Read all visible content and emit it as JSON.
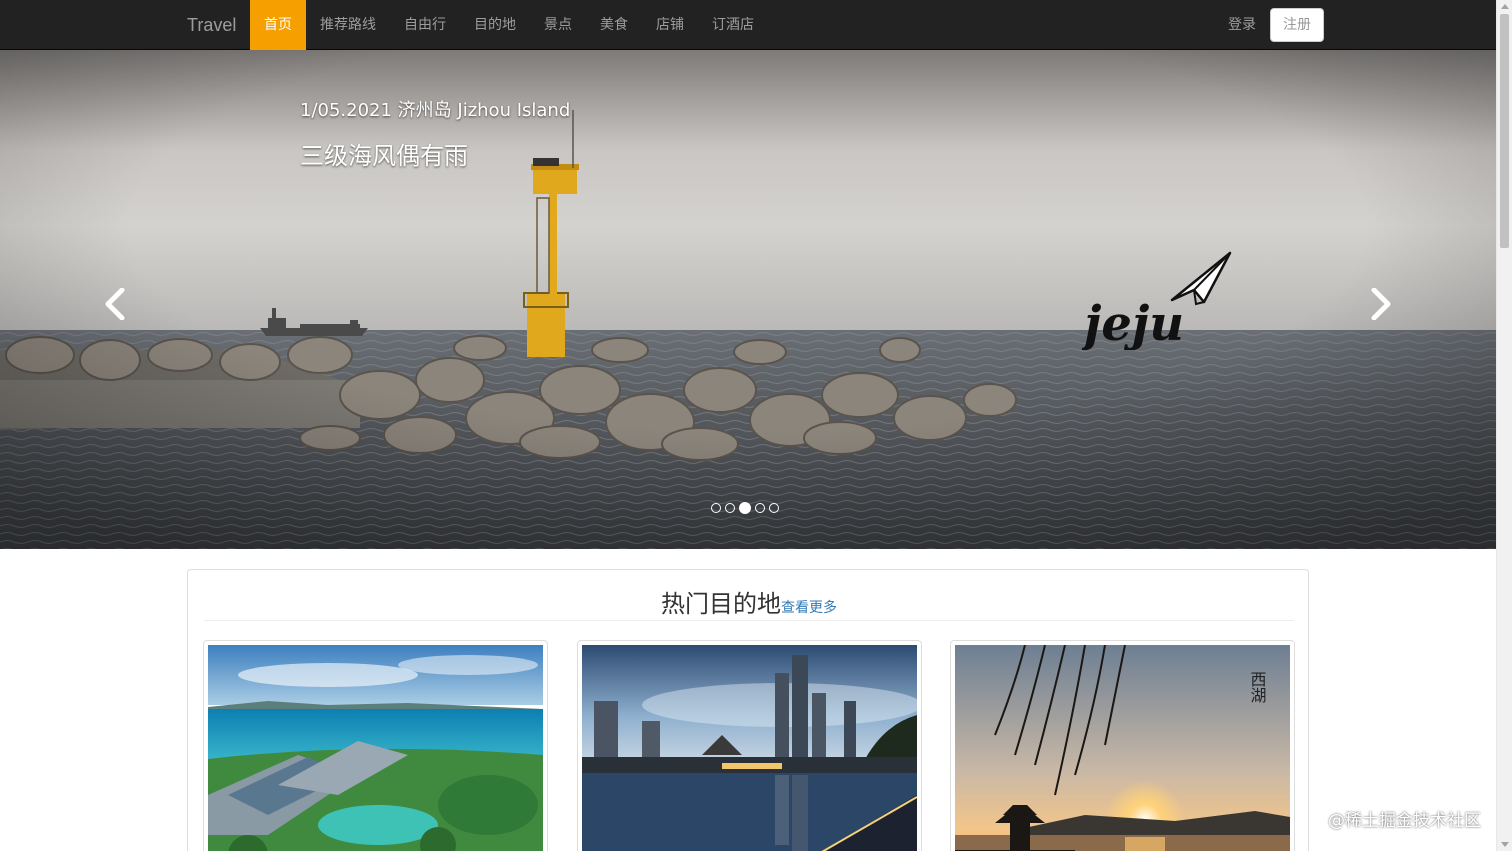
{
  "navbar": {
    "brand": "Travel",
    "items": [
      {
        "label": "首页",
        "active": true
      },
      {
        "label": "推荐路线"
      },
      {
        "label": "自由行"
      },
      {
        "label": "目的地"
      },
      {
        "label": "景点"
      },
      {
        "label": "美食"
      },
      {
        "label": "店铺"
      },
      {
        "label": "订酒店"
      }
    ],
    "login": "登录",
    "register": "注册",
    "active_color": "#f5a000"
  },
  "carousel": {
    "caption_date": "1/05.2021  济州岛  Jizhou Island",
    "caption_title": "三级海风偶有雨",
    "logo_text": "jeju",
    "slide_count": 5,
    "active_index": 2,
    "prev_icon": "chevron-left-icon",
    "next_icon": "chevron-right-icon"
  },
  "hot_destinations": {
    "title": "热门目的地",
    "more": "查看更多",
    "cards": [
      {
        "image": "tropical-resort-aerial"
      },
      {
        "image": "city-skyline-river-dusk"
      },
      {
        "image": "west-lake-sunset",
        "stamp_text": "西湖"
      }
    ]
  },
  "watermark": "@稀土掘金技术社区"
}
